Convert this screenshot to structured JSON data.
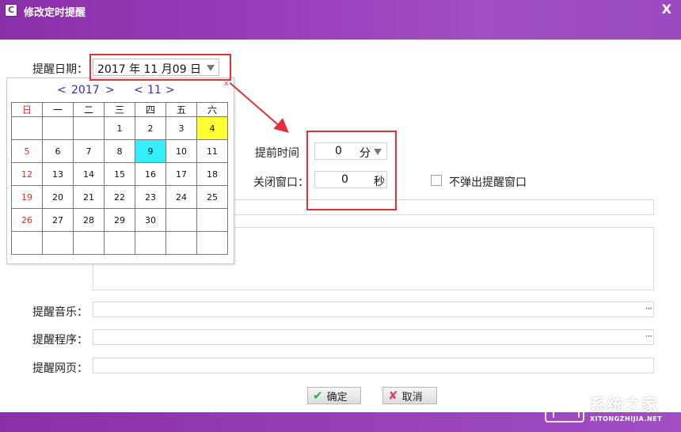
{
  "window": {
    "title": "修改定时提醒",
    "close_symbol": "X"
  },
  "form": {
    "date_label": "提醒日期：",
    "date_value": "2017 年 11 月09 日",
    "advance_label": "提前时间",
    "advance_value": "0",
    "advance_unit": "分",
    "close_label": "关闭窗口：",
    "close_value": "0",
    "close_unit": "秒",
    "no_popup_label": "不弹出提醒窗口",
    "no_popup_checked": false,
    "music_label": "提醒音乐：",
    "program_label": "提醒程序：",
    "webpage_label": "提醒网页：",
    "browse_symbol": "···"
  },
  "calendar": {
    "year": "2017",
    "month": "11",
    "prev_symbol": "<",
    "next_symbol": ">",
    "close_symbol": "x",
    "weekdays": [
      "日",
      "一",
      "二",
      "三",
      "四",
      "五",
      "六"
    ],
    "weeks": [
      [
        "",
        "",
        "",
        "1",
        "2",
        "3",
        "4"
      ],
      [
        "5",
        "6",
        "7",
        "8",
        "9",
        "10",
        "11"
      ],
      [
        "12",
        "13",
        "14",
        "15",
        "16",
        "17",
        "18"
      ],
      [
        "19",
        "20",
        "21",
        "22",
        "23",
        "24",
        "25"
      ],
      [
        "26",
        "27",
        "28",
        "29",
        "30",
        "",
        ""
      ],
      [
        "",
        "",
        "",
        "",
        "",
        "",
        ""
      ]
    ],
    "today": "4",
    "selected": "9"
  },
  "buttons": {
    "ok": "确定",
    "cancel": "取消",
    "ok_icon": "check-icon",
    "cancel_icon": "x-icon"
  },
  "watermark": {
    "name": "系统之家",
    "url": "XITONGZHIJIA.NET"
  },
  "colors": {
    "titlebar": "#9a3cbd",
    "annotation": "#e0303a",
    "today": "#ffff33",
    "selected": "#33f0ff",
    "nav": "#2d36a6"
  }
}
